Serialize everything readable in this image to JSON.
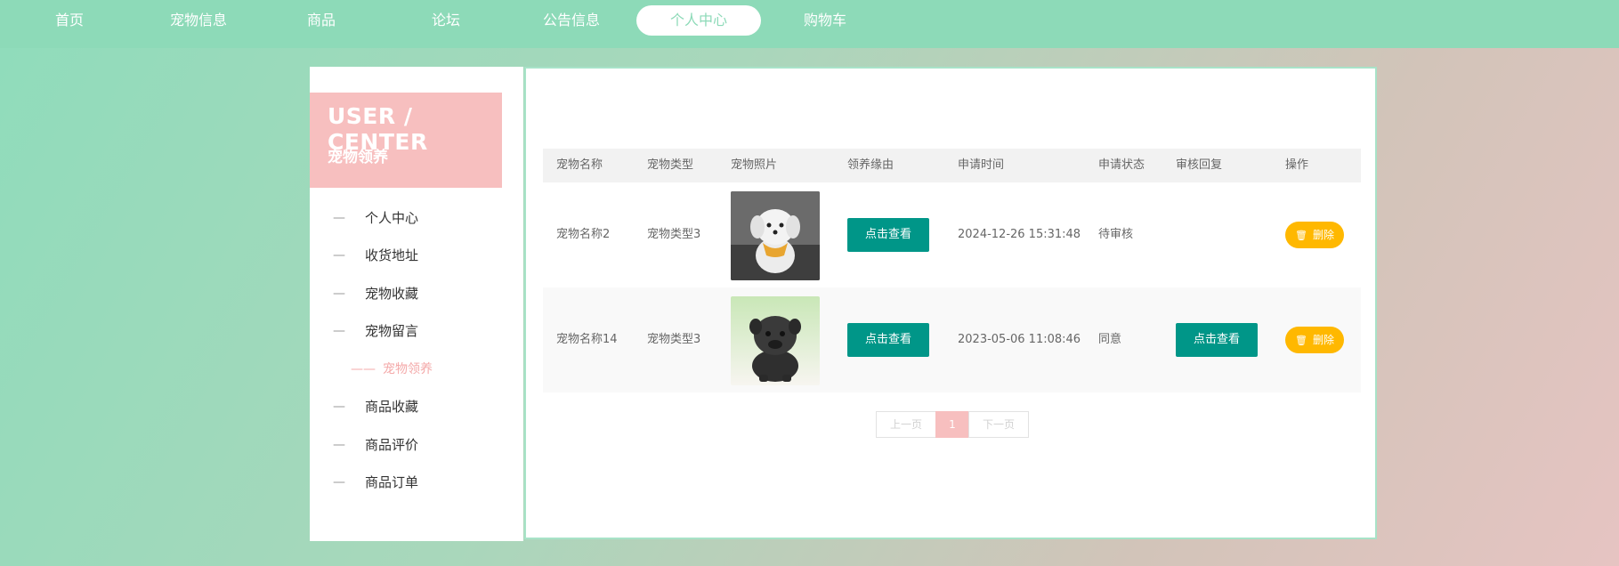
{
  "nav": {
    "items": [
      "首页",
      "宠物信息",
      "商品",
      "论坛",
      "公告信息",
      "个人中心",
      "购物车"
    ],
    "active_index": 5
  },
  "sidebar": {
    "title": "USER / CENTER",
    "subtitle": "宠物领养",
    "items": [
      "个人中心",
      "收货地址",
      "宠物收藏",
      "宠物留言",
      "宠物领养",
      "商品收藏",
      "商品评价",
      "商品订单"
    ],
    "active_index": 4,
    "dash": "—",
    "active_dash": "——"
  },
  "table": {
    "headers": [
      "宠物名称",
      "宠物类型",
      "宠物照片",
      "领养缘由",
      "申请时间",
      "申请状态",
      "审核回复",
      "操作"
    ],
    "rows": [
      {
        "name": "宠物名称2",
        "type": "宠物类型3",
        "photo": "white-puppy-photo",
        "reason_btn": "点击查看",
        "time": "2024-12-26 15:31:48",
        "status": "待审核",
        "reply_btn": "",
        "delete_btn": "删除"
      },
      {
        "name": "宠物名称14",
        "type": "宠物类型3",
        "photo": "black-pug-photo",
        "reason_btn": "点击查看",
        "time": "2023-05-06 11:08:46",
        "status": "同意",
        "reply_btn": "点击查看",
        "delete_btn": "删除"
      }
    ]
  },
  "pagination": {
    "prev": "上一页",
    "current": "1",
    "next": "下一页"
  },
  "colors": {
    "accent": "#8ddab8",
    "pink": "#f7bfbf",
    "teal": "#009688",
    "amber": "#ffb800"
  }
}
